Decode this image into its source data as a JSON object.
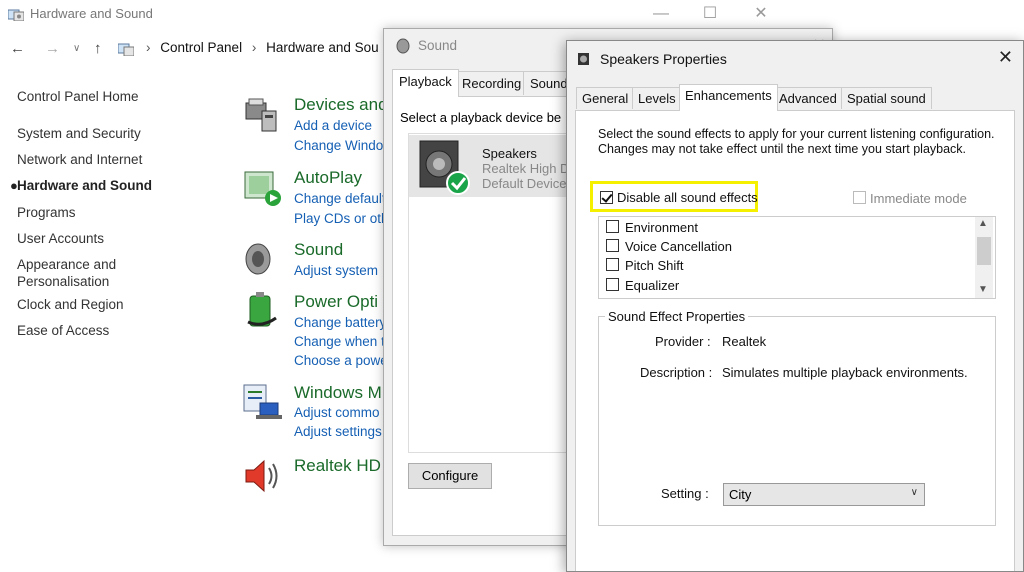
{
  "control_panel": {
    "title": "Hardware and Sound",
    "breadcrumb": [
      "Control Panel",
      "Hardware and Sou"
    ],
    "left_nav": [
      {
        "label": "Control Panel Home",
        "active": false
      },
      {
        "label": "System and Security",
        "active": false
      },
      {
        "label": "Network and Internet",
        "active": false
      },
      {
        "label": "Hardware and Sound",
        "active": true
      },
      {
        "label": "Programs",
        "active": false
      },
      {
        "label": "User Accounts",
        "active": false
      },
      {
        "label": "Appearance and",
        "active": false
      },
      {
        "label": "Personalisation",
        "active": false
      },
      {
        "label": "Clock and Region",
        "active": false
      },
      {
        "label": "Ease of Access",
        "active": false
      }
    ],
    "categories": [
      {
        "title": "Devices and",
        "links": [
          "Add a device",
          "Change Windo"
        ]
      },
      {
        "title": "AutoPlay",
        "links": [
          "Change default",
          "Play CDs or oth"
        ]
      },
      {
        "title": "Sound",
        "links": [
          "Adjust system"
        ]
      },
      {
        "title": "Power Opti",
        "links": [
          "Change battery",
          "Change when t",
          "Choose a powe"
        ]
      },
      {
        "title": "Windows M",
        "links": [
          "Adjust commo",
          "Adjust settings"
        ]
      },
      {
        "title": "Realtek HD",
        "links": []
      }
    ]
  },
  "sound_window": {
    "title": "Sound",
    "tabs": [
      "Playback",
      "Recording",
      "Sounds"
    ],
    "active_tab": "Playback",
    "hint": "Select a playback device be",
    "device": {
      "name": "Speakers",
      "driver": "Realtek High D",
      "status": "Default Device"
    },
    "configure_label": "Configure"
  },
  "speakers_props": {
    "title": "Speakers Properties",
    "tabs": [
      "General",
      "Levels",
      "Enhancements",
      "Advanced",
      "Spatial sound"
    ],
    "active_tab": "Enhancements",
    "description": "Select the sound effects to apply for your current listening configuration. Changes may not take effect until the next time you start playback.",
    "disable_all_label": "Disable all sound effects",
    "disable_all_checked": true,
    "immediate_mode_label": "Immediate mode",
    "effects": [
      {
        "label": "Environment",
        "checked": false
      },
      {
        "label": "Voice Cancellation",
        "checked": false
      },
      {
        "label": "Pitch Shift",
        "checked": false
      },
      {
        "label": "Equalizer",
        "checked": false
      }
    ],
    "group_title": "Sound Effect Properties",
    "provider_key": "Provider :",
    "provider_value": "Realtek",
    "description_key": "Description :",
    "description_value": "Simulates multiple playback environments.",
    "setting_key": "Setting :",
    "setting_value": "City"
  },
  "colors": {
    "highlight": "#f5f000",
    "category_title": "#1a6a2a",
    "link": "#1660b4"
  }
}
